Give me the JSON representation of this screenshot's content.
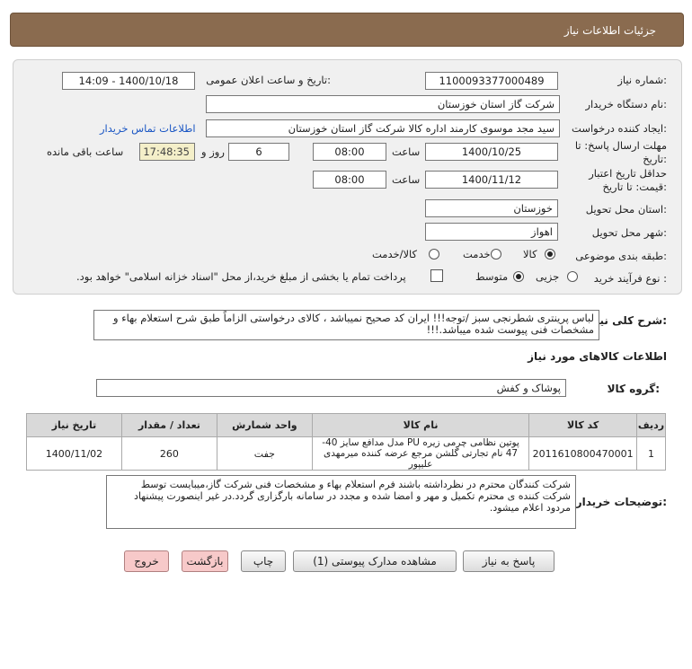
{
  "header": {
    "title": "جزئیات اطلاعات نیاز"
  },
  "labels": {
    "need_number": "شماره نیاز:",
    "announce_datetime": "تاریخ و ساعت اعلان عمومی:",
    "buyer_org": "نام دستگاه خریدار:",
    "requester": "ایجاد کننده درخواست:",
    "buyer_contact": "اطلاعات تماس خریدار",
    "reply_deadline": "مهلت ارسال پاسخ: تا تاریخ:",
    "time": "ساعت",
    "day_and": "روز و",
    "time_remaining": "ساعت باقی مانده",
    "price_validity": "حداقل تاریخ اعتبار قیمت: تا تاریخ:",
    "delivery_province": "استان محل تحویل:",
    "delivery_city": "شهر محل تحویل:",
    "category": "طبقه بندی موضوعی:",
    "process_type": "نوع فرآیند خرید :",
    "general_desc": "شرح کلی نیاز:",
    "goods_info": "اطلاعات کالاهای مورد نیاز",
    "goods_group": "گروه کالا:",
    "buyer_notes": "توضیحات خریدار:"
  },
  "values": {
    "need_number": "1100093377000489",
    "announce_datetime": "1400/10/18 - 14:09",
    "buyer_org": "شرکت گاز استان خوزستان",
    "requester": "سید مجد موسوی کارمند اداره کالا شرکت گاز استان خوزستان",
    "reply_date": "1400/10/25",
    "reply_time": "08:00",
    "days": "6",
    "remaining": "17:48:35",
    "validity_date": "1400/11/12",
    "validity_time": "08:00",
    "province": "خوزستان",
    "city": "اهواز",
    "goods_group": "پوشاک و کفش"
  },
  "category_options": {
    "goods": "کالا",
    "service": "خدمت",
    "goods_service": "کالا/خدمت",
    "selected": "کالا"
  },
  "process_options": {
    "minor": "جزیی",
    "medium": "متوسط",
    "selected": "متوسط",
    "treasury_note": "پرداخت تمام یا بخشی از مبلغ خرید،از محل \"اسناد خزانه اسلامی\" خواهد بود."
  },
  "general_desc": "لباس پرینتری شطرنجی سبز /توجه!!! ایران کد صحیح نمیباشد ، کالای درخواستی الزاماً طبق شرح استعلام بهاء و مشخصات فنی پیوست شده میباشد.!!!",
  "table": {
    "headers": [
      "ردیف",
      "کد کالا",
      "نام کالا",
      "واحد شمارش",
      "تعداد / مقدار",
      "تاریخ نیاز"
    ],
    "rows": [
      {
        "row": "1",
        "code": "2011610800470001",
        "name": "پوتین نظامی چرمی زیره PU مدل مدافع سایز 40-47 نام تجارتی گلشن مرجع عرضه کننده میرمهدی علیپور",
        "unit": "جفت",
        "qty": "260",
        "date": "1400/11/02"
      }
    ]
  },
  "buyer_notes": "شرکت کنندگان محترم در نظرداشته باشند فرم استعلام بهاء و مشخصات فنی شرکت گاز،میبایست توسط شرکت کننده ی محترم  تکمیل و مهر و امضا شده و مجدد در سامانه بارگزاری گردد.در غیر اینصورت پیشنهاد مردود اعلام میشود.",
  "buttons": {
    "reply": "پاسخ به نیاز",
    "attachments": "مشاهده مدارک پیوستی (1)",
    "print": "چاپ",
    "back": "بازگشت",
    "exit": "خروج"
  }
}
